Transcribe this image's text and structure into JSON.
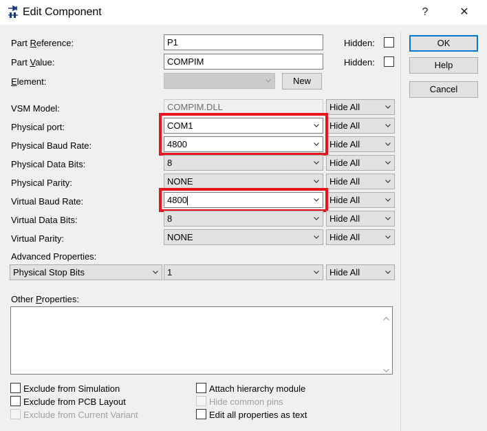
{
  "window": {
    "title": "Edit Component",
    "help_glyph": "?",
    "close_glyph": "✕"
  },
  "fields": {
    "part_reference": {
      "label_pre": "Part ",
      "label_u": "R",
      "label_post": "eference:",
      "value": "P1"
    },
    "part_value": {
      "label_pre": "Part ",
      "label_u": "V",
      "label_post": "alue:",
      "value": "COMPIM"
    },
    "element": {
      "label_pre": "",
      "label_u": "E",
      "label_post": "lement:",
      "value": ""
    },
    "hidden_label": "Hidden:"
  },
  "new_button": "New",
  "rows": [
    {
      "label": "VSM Model:",
      "value": "COMPIM.DLL",
      "hide": "Hide All"
    },
    {
      "label": "Physical port:",
      "value": "COM1",
      "hide": "Hide All"
    },
    {
      "label": "Physical Baud Rate:",
      "value": "4800",
      "hide": "Hide All"
    },
    {
      "label": "Physical Data Bits:",
      "value": "8",
      "hide": "Hide All"
    },
    {
      "label": "Physical Parity:",
      "value": "NONE",
      "hide": "Hide All"
    },
    {
      "label": "Virtual Baud Rate:",
      "value": "4800",
      "hide": "Hide All"
    },
    {
      "label": "Virtual Data Bits:",
      "value": "8",
      "hide": "Hide All"
    },
    {
      "label": "Virtual Parity:",
      "value": "NONE",
      "hide": "Hide All"
    }
  ],
  "advanced": {
    "label": "Advanced Properties:",
    "property": "Physical Stop Bits",
    "value": "1",
    "hide": "Hide All"
  },
  "other_properties": {
    "label_pre": "Other ",
    "label_u": "P",
    "label_post": "roperties:",
    "value": ""
  },
  "checkboxes": {
    "exclude_simulation": "Exclude from Simulation",
    "exclude_pcb": "Exclude from PCB Layout",
    "exclude_variant": "Exclude from Current Variant",
    "attach_hierarchy": "Attach hierarchy module",
    "hide_common_pins": "Hide common pins",
    "edit_all_text": "Edit all properties as text"
  },
  "buttons": {
    "ok": "OK",
    "help": "Help",
    "cancel": "Cancel"
  },
  "colors": {
    "highlight": "#e8141f",
    "accent": "#0078d7"
  }
}
